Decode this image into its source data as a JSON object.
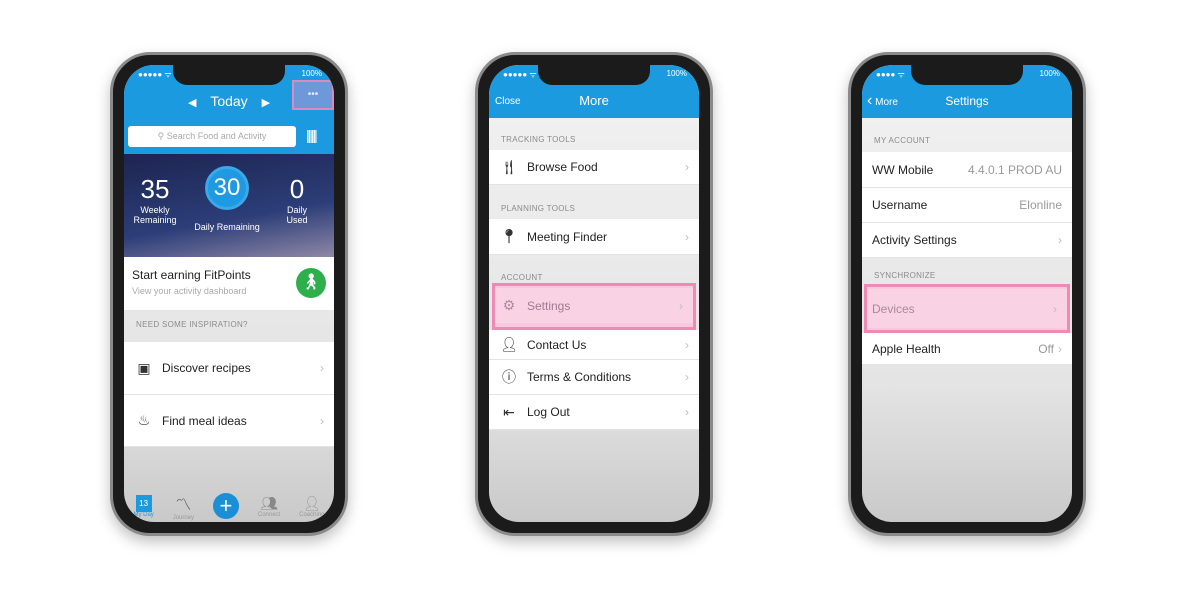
{
  "phone1": {
    "status_carrier": "●●●●● ᯤ",
    "status_battery": "100%",
    "nav_title": "Today",
    "more_icon": "•••",
    "search_placeholder": "Search Food and Activity",
    "weekly_value": "35",
    "weekly_label": "Weekly Remaining",
    "daily_value": "30",
    "daily_label": "Daily Remaining",
    "used_value": "0",
    "used_label": "Daily Used",
    "fitpoints_title": "Start earning FitPoints",
    "fitpoints_sub": "View your activity dashboard",
    "section": "NEED SOME INSPIRATION?",
    "items": [
      {
        "label": "Discover recipes"
      },
      {
        "label": "Find meal ideas"
      }
    ],
    "tabs": [
      {
        "label": "My Day",
        "badge": "13"
      },
      {
        "label": "Journey"
      },
      {
        "label": ""
      },
      {
        "label": "Connect"
      },
      {
        "label": "Coaching"
      }
    ]
  },
  "phone2": {
    "status_carrier": "●●●●● ᯤ",
    "status_battery": "100%",
    "close": "Close",
    "title": "More",
    "sections": [
      "TRACKING TOOLS",
      "PLANNING TOOLS",
      "ACCOUNT"
    ],
    "items": [
      {
        "label": "Browse Food"
      },
      {
        "label": "Meeting Finder"
      },
      {
        "label": "Settings"
      },
      {
        "label": "Contact Us"
      },
      {
        "label": "Terms & Conditions"
      },
      {
        "label": "Log Out"
      }
    ]
  },
  "phone3": {
    "status_carrier": "●●●● ᯤ",
    "status_battery": "100%",
    "back": "More",
    "title": "Settings",
    "sections": [
      "MY ACCOUNT",
      "SYNCHRONIZE"
    ],
    "items": [
      {
        "label": "WW Mobile",
        "value": "4.4.0.1 PROD AU"
      },
      {
        "label": "Username",
        "value": "Elonline"
      },
      {
        "label": "Activity Settings"
      },
      {
        "label": "Devices"
      },
      {
        "label": "Apple Health",
        "value": "Off"
      }
    ]
  },
  "colors": {
    "header_blue": "#1b9ae0",
    "highlight": "#ee8ab5",
    "fitpoints_green": "#2db04b"
  }
}
